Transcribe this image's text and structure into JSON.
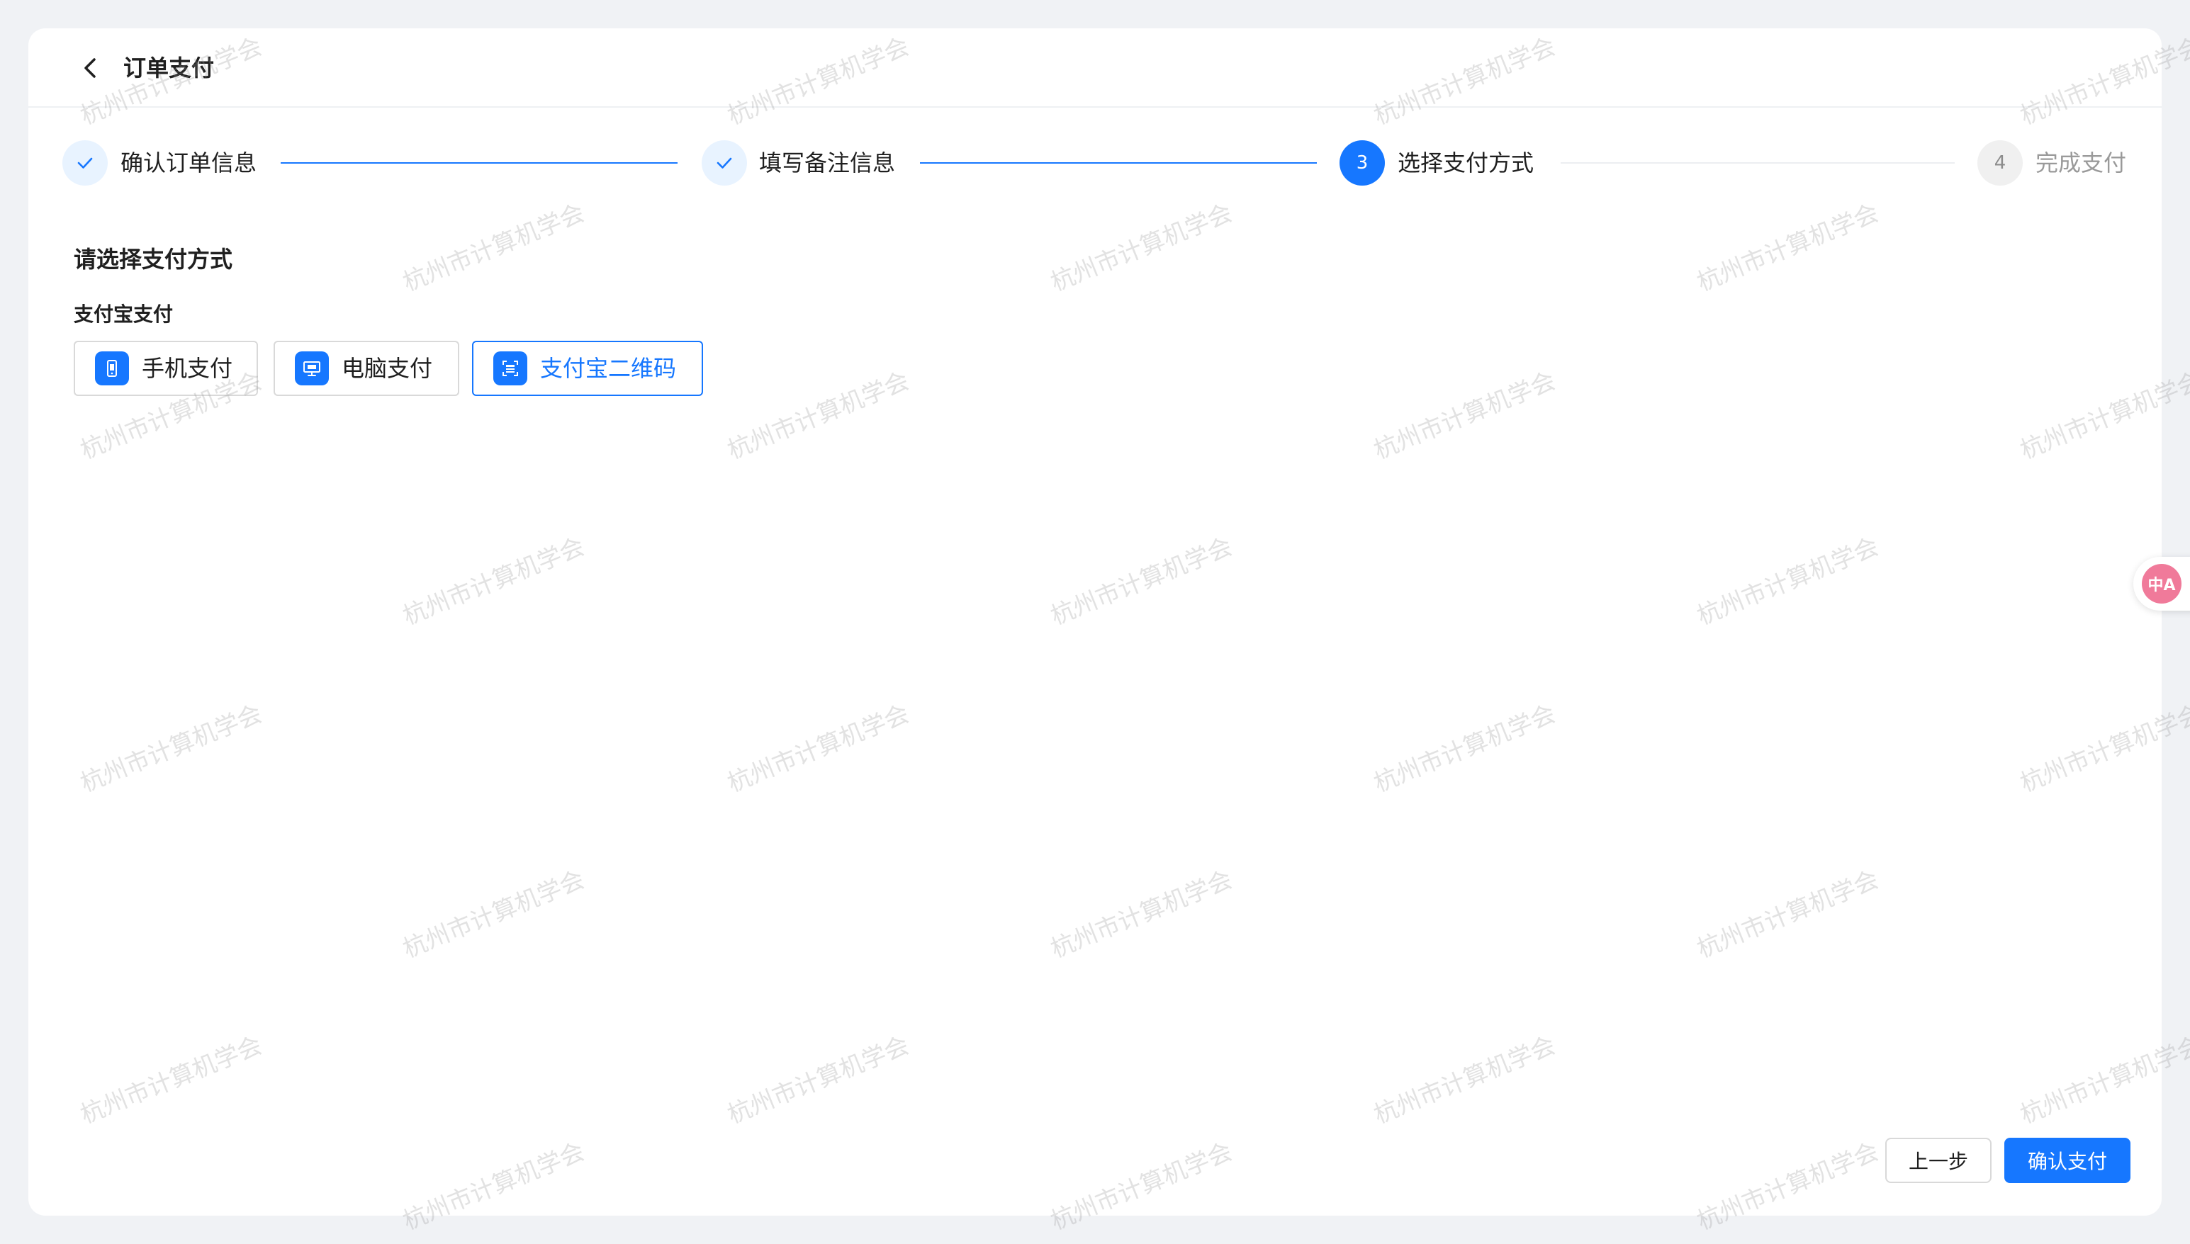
{
  "header": {
    "title": "订单支付",
    "back_icon": "chevron-left-icon"
  },
  "steps": [
    {
      "index": "1",
      "label": "确认订单信息",
      "status": "done",
      "icon": "check-icon"
    },
    {
      "index": "2",
      "label": "填写备注信息",
      "status": "done",
      "icon": "check-icon"
    },
    {
      "index": "3",
      "label": "选择支付方式",
      "status": "active"
    },
    {
      "index": "4",
      "label": "完成支付",
      "status": "wait"
    }
  ],
  "main": {
    "section_title": "请选择支付方式",
    "group_title": "支付宝支付",
    "options": [
      {
        "label": "手机支付",
        "icon": "mobile-icon",
        "selected": false
      },
      {
        "label": "电脑支付",
        "icon": "desktop-icon",
        "selected": false
      },
      {
        "label": "支付宝二维码",
        "icon": "qrcode-icon",
        "selected": true
      }
    ]
  },
  "footer": {
    "prev_label": "上一步",
    "confirm_label": "确认支付"
  },
  "watermark": {
    "text": "杭州市计算机学会"
  },
  "translate_widget": {
    "icon": "translate-icon",
    "glyph": "中A"
  },
  "colors": {
    "primary": "#1677ff",
    "background": "#f0f2f5",
    "step_done_bg": "#e8f3ff",
    "step_wait_bg": "#f0f0f0",
    "border": "#d9d9d9"
  }
}
